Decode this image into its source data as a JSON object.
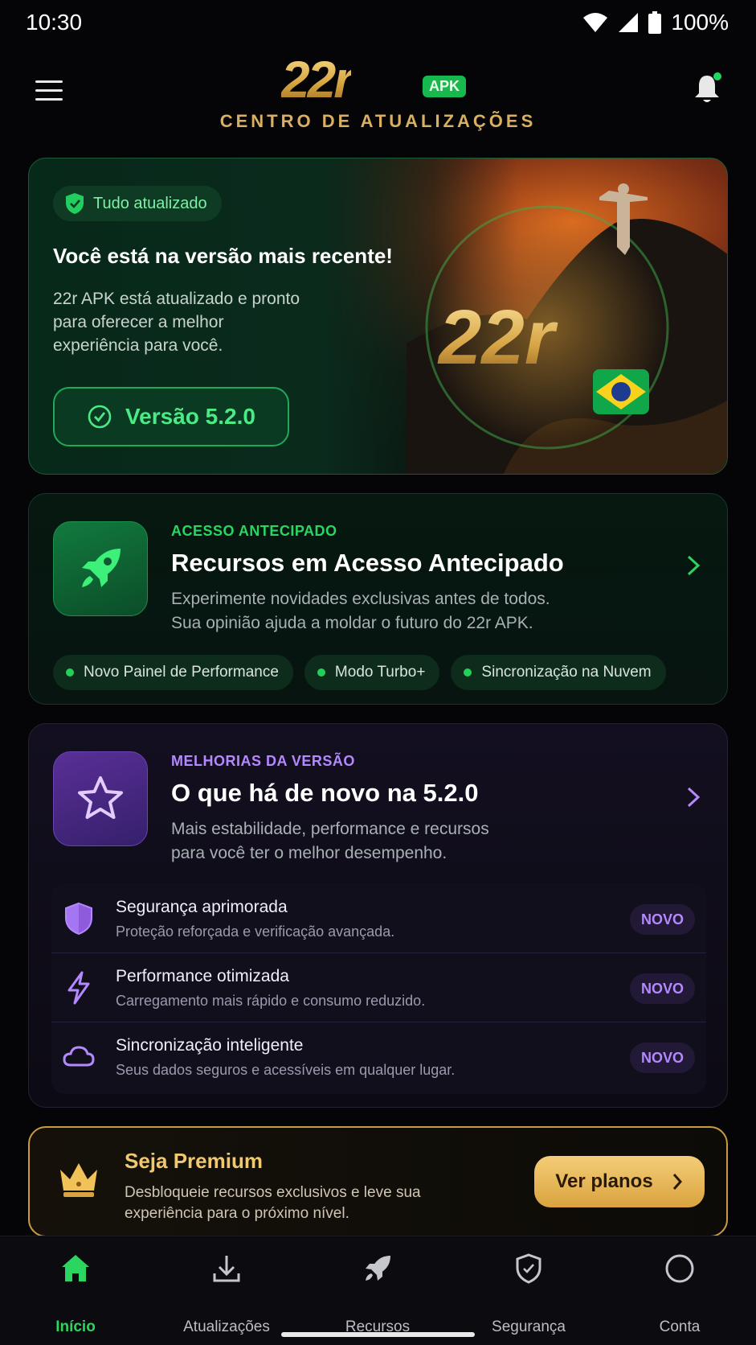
{
  "status_bar": {
    "time": "10:30",
    "battery": "100%"
  },
  "header": {
    "logo_text": "22r",
    "logo_badge": "APK",
    "subtitle": "CENTRO DE ATUALIZAÇÕES"
  },
  "hero": {
    "badge": "Tudo atualizado",
    "title": "Você está na versão mais recente!",
    "description": "22r APK está atualizado e pronto para oferecer a melhor experiência para você.",
    "version_button": "Versão 5.2.0",
    "art_logo": "22r"
  },
  "early_access": {
    "kicker": "ACESSO ANTECIPADO",
    "title": "Recursos em Acesso Antecipado",
    "description_line1": "Experimente novidades exclusivas antes de todos.",
    "description_line2": "Sua opinião ajuda a moldar o futuro do 22r APK.",
    "chips": [
      "Novo Painel de Performance",
      "Modo Turbo+",
      "Sincronização na Nuvem"
    ]
  },
  "improvements": {
    "kicker": "MELHORIAS DA VERSÃO",
    "title": "O que há de novo na 5.2.0",
    "description_line1": "Mais estabilidade, performance e recursos",
    "description_line2": "para você ter o melhor desempenho.",
    "items": [
      {
        "title": "Segurança aprimorada",
        "subtitle": "Proteção reforçada e verificação avançada.",
        "badge": "NOVO",
        "icon": "shield-icon"
      },
      {
        "title": "Performance otimizada",
        "subtitle": "Carregamento mais rápido e consumo reduzido.",
        "badge": "NOVO",
        "icon": "lightning-icon"
      },
      {
        "title": "Sincronização inteligente",
        "subtitle": "Seus dados seguros e acessíveis em qualquer lugar.",
        "badge": "NOVO",
        "icon": "cloud-icon"
      }
    ]
  },
  "premium": {
    "title": "Seja Premium",
    "description": "Desbloqueie recursos exclusivos e leve sua experiência para o próximo nível.",
    "button": "Ver planos"
  },
  "bottom_nav": {
    "items": [
      {
        "label": "Início",
        "icon": "home-icon",
        "active": true
      },
      {
        "label": "Atualizações",
        "icon": "download-icon",
        "active": false
      },
      {
        "label": "Recursos",
        "icon": "rocket-icon",
        "active": false
      },
      {
        "label": "Segurança",
        "icon": "shield-icon",
        "active": false
      },
      {
        "label": "Conta",
        "icon": "account-icon",
        "active": false
      }
    ]
  },
  "colors": {
    "accent_green": "#2bd55f",
    "accent_purple": "#b488ff",
    "accent_gold": "#f2c86e",
    "background": "#050507"
  }
}
